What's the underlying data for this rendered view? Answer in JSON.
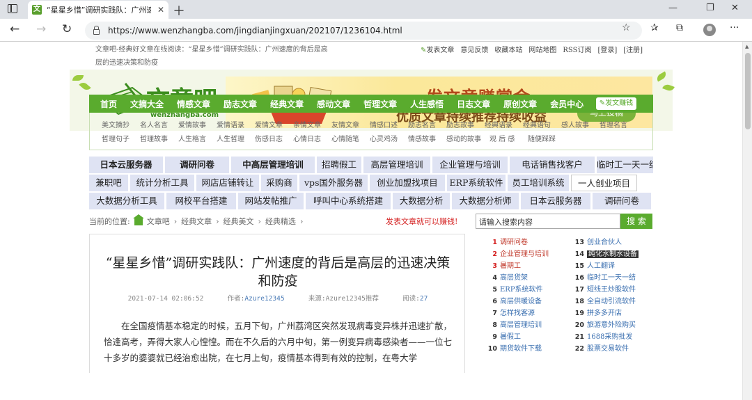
{
  "browser": {
    "tab_title": "“星星乡惜”调研实践队：广州速度",
    "favicon_letter": "文",
    "url": "https://www.wenzhangba.com/jingdianjingxuan/202107/1236104.html"
  },
  "topbar": {
    "breadcrumb_text": "文章吧-经典好文章在线阅读：“星星乡惜”调研实践队：广州速度的背后是高层的迅速决策和防疫",
    "links": [
      "发表文章",
      "意见反馈",
      "收藏本站",
      "网站地图",
      "RSS订阅",
      "[登录]",
      "[注册]"
    ]
  },
  "logo": {
    "cn": "文章吧",
    "en": "wenzhangba.com"
  },
  "ad": {
    "title": "发文章赚赏金",
    "subtitle": "优质文章持续推荐持续收益",
    "button": "马上投稿"
  },
  "main_nav": [
    "首页",
    "文摘大全",
    "情感文章",
    "励志文章",
    "经典文章",
    "感动文章",
    "哲理文章",
    "人生感悟",
    "日志文章",
    "原创文章",
    "会员中心"
  ],
  "main_nav_button": "发文赚钱",
  "sub_nav": [
    [
      "美文摘抄",
      "名人名言",
      "爱情故事",
      "爱情语录",
      "爱情文章",
      "亲情文章",
      "友情文章",
      "情感口述",
      "励志名言",
      "励志故事",
      "经典语录",
      "经典语句",
      "感人故事",
      "哲理名言"
    ],
    [
      "哲理句子",
      "哲理故事",
      "人生格言",
      "人生哲理",
      "伤感日志",
      "心情日志",
      "心情随笔",
      "心灵鸡汤",
      "情感故事",
      "感动的故事",
      "观 后 感",
      "随便踩踩"
    ]
  ],
  "link_grid": [
    [
      "日本云服务器",
      "调研问卷",
      "中高层管理培训",
      "招聘假工",
      "高层管理培训",
      "企业管理与培训",
      "电话销售找客户",
      "临时工一天一结"
    ],
    [
      "兼职吧",
      "统计分析工具",
      "网店店铺转让",
      "采购商",
      "vps国外服务器",
      "创业加盟找项目",
      "ERP系统软件",
      "员工培训系统",
      "一人创业项目"
    ],
    [
      "大数据分析工具",
      "网校平台搭建",
      "网站发帖推广",
      "呼叫中心系统搭建",
      "大数据分析",
      "大数据分析师",
      "日本云服务器",
      "调研问卷"
    ]
  ],
  "location": {
    "label": "当前的位置:",
    "items": [
      "文章吧",
      "经典文章",
      "经典美文",
      "经典精选"
    ]
  },
  "promo": "发表文章就可以赚钱!",
  "search": {
    "placeholder": "请输入搜索内容",
    "button": "搜 索"
  },
  "article": {
    "title": "“星星乡惜”调研实践队：广州速度的背后是高层的迅速决策和防疫",
    "date": "2021-07-14 02:06:52",
    "author_label": "作者:",
    "author": "Azure12345",
    "source_label": "来源:",
    "source": "Azure12345推荐",
    "reads_label": "阅读:",
    "reads": "27",
    "body": "在全国疫情基本稳定的时候，五月下旬，广州荔湾区突然发现病毒变异株并迅速扩散，恰逢高考，弄得大家人心惶惶。而在不久后的六月中旬，第一例变异病毒感染者——一位七十多岁的婆婆就已经治愈出院，在七月上旬，疫情基本得到有效的控制，在粤大学"
  },
  "ranking": [
    [
      "1",
      "调研问卷"
    ],
    [
      "13",
      "创业合伙人"
    ],
    [
      "2",
      "企业管理与培训"
    ],
    [
      "14",
      "纯化水制水设备"
    ],
    [
      "3",
      "暑期工"
    ],
    [
      "15",
      "人工翻译"
    ],
    [
      "4",
      "高层货架"
    ],
    [
      "16",
      "临时工一天一结"
    ],
    [
      "5",
      "ERP系统软件"
    ],
    [
      "17",
      "短线王炒股软件"
    ],
    [
      "6",
      "高层供暖设备"
    ],
    [
      "18",
      "全自动引流软件"
    ],
    [
      "7",
      "怎样找客源"
    ],
    [
      "19",
      "拼多多开店"
    ],
    [
      "8",
      "高层管理培训"
    ],
    [
      "20",
      "旅游意外险购买"
    ],
    [
      "9",
      "暑假工"
    ],
    [
      "21",
      "1688采购批发"
    ],
    [
      "10",
      "期货软件下载"
    ],
    [
      "22",
      "股票交易软件"
    ]
  ]
}
